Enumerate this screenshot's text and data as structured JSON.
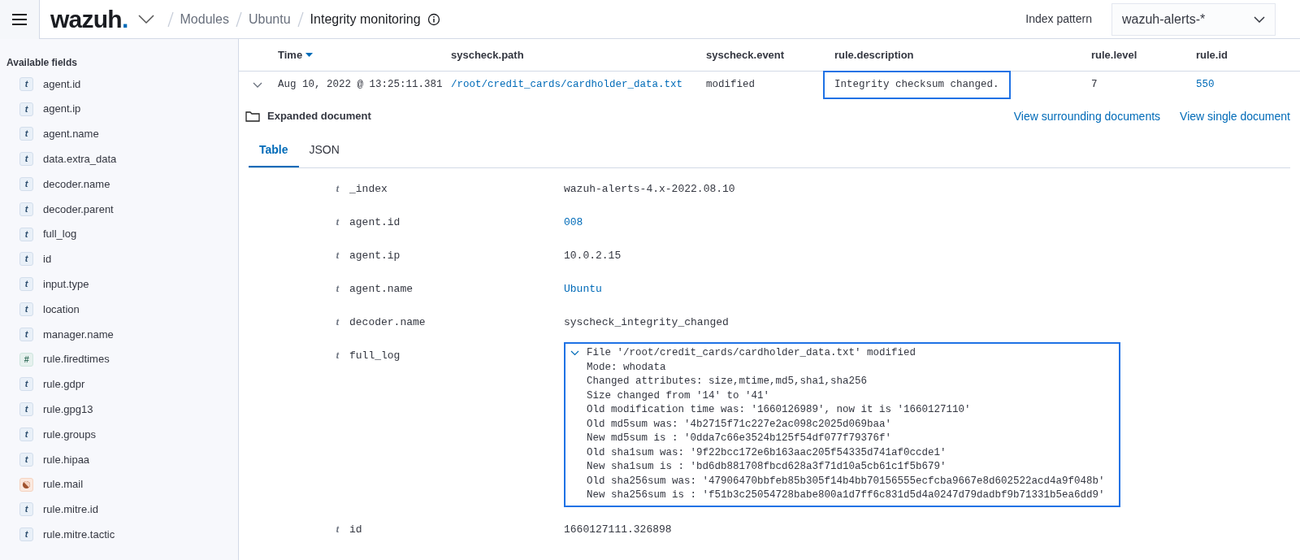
{
  "header": {
    "logo": "wazuh.",
    "breadcrumbs": [
      "Modules",
      "Ubuntu",
      "Integrity monitoring"
    ],
    "index_pattern_label": "Index pattern",
    "index_pattern_value": "wazuh-alerts-*"
  },
  "sidebar": {
    "section_title": "Available fields",
    "fields": [
      {
        "name": "agent.id",
        "kind": "string",
        "glyph": "t"
      },
      {
        "name": "agent.ip",
        "kind": "string",
        "glyph": "t"
      },
      {
        "name": "agent.name",
        "kind": "string",
        "glyph": "t"
      },
      {
        "name": "data.extra_data",
        "kind": "string",
        "glyph": "t"
      },
      {
        "name": "decoder.name",
        "kind": "string",
        "glyph": "t"
      },
      {
        "name": "decoder.parent",
        "kind": "string",
        "glyph": "t"
      },
      {
        "name": "full_log",
        "kind": "string",
        "glyph": "t"
      },
      {
        "name": "id",
        "kind": "string",
        "glyph": "t"
      },
      {
        "name": "input.type",
        "kind": "string",
        "glyph": "t"
      },
      {
        "name": "location",
        "kind": "string",
        "glyph": "t"
      },
      {
        "name": "manager.name",
        "kind": "string",
        "glyph": "t"
      },
      {
        "name": "rule.firedtimes",
        "kind": "number",
        "glyph": "#"
      },
      {
        "name": "rule.gdpr",
        "kind": "string",
        "glyph": "t"
      },
      {
        "name": "rule.gpg13",
        "kind": "string",
        "glyph": "t"
      },
      {
        "name": "rule.groups",
        "kind": "string",
        "glyph": "t"
      },
      {
        "name": "rule.hipaa",
        "kind": "string",
        "glyph": "t"
      },
      {
        "name": "rule.mail",
        "kind": "boolean"
      },
      {
        "name": "rule.mitre.id",
        "kind": "string",
        "glyph": "t"
      },
      {
        "name": "rule.mitre.tactic",
        "kind": "string",
        "glyph": "t"
      }
    ]
  },
  "table": {
    "columns": [
      {
        "label": "Time",
        "sorted": true
      },
      {
        "label": "syscheck.path",
        "sorted": false
      },
      {
        "label": "syscheck.event",
        "sorted": false
      },
      {
        "label": "rule.description",
        "sorted": false
      },
      {
        "label": "rule.level",
        "sorted": false
      },
      {
        "label": "rule.id",
        "sorted": false
      }
    ],
    "rows": [
      {
        "expanded": true,
        "cells": [
          {
            "text": "Aug 10, 2022 @ 13:25:11.381",
            "link": false,
            "highlighted": false
          },
          {
            "text": "/root/credit_cards/cardholder_data.txt",
            "link": true,
            "highlighted": false
          },
          {
            "text": "modified",
            "link": false,
            "highlighted": false
          },
          {
            "text": "Integrity checksum changed.",
            "link": false,
            "highlighted": true
          },
          {
            "text": "7",
            "link": false,
            "highlighted": false
          },
          {
            "text": "550",
            "link": true,
            "highlighted": false
          }
        ]
      }
    ]
  },
  "document": {
    "title": "Expanded document",
    "links": [
      "View surrounding documents",
      "View single document"
    ],
    "tabs": [
      {
        "label": "Table",
        "selected": true
      },
      {
        "label": "JSON",
        "selected": false
      }
    ],
    "fields": [
      {
        "glyph": "t",
        "name": "_index",
        "value": "wazuh-alerts-4.x-2022.08.10",
        "link": false,
        "highlighted": false
      },
      {
        "glyph": "t",
        "name": "agent.id",
        "value": "008",
        "link": true,
        "highlighted": false
      },
      {
        "glyph": "t",
        "name": "agent.ip",
        "value": "10.0.2.15",
        "link": false,
        "highlighted": false
      },
      {
        "glyph": "t",
        "name": "agent.name",
        "value": "Ubuntu",
        "link": true,
        "highlighted": false
      },
      {
        "glyph": "t",
        "name": "decoder.name",
        "value": "syscheck_integrity_changed",
        "link": false,
        "highlighted": false
      },
      {
        "glyph": "t",
        "name": "full_log",
        "highlighted": true,
        "expanded": true,
        "lines": [
          "File '/root/credit_cards/cardholder_data.txt' modified",
          "Mode: whodata",
          "Changed attributes: size,mtime,md5,sha1,sha256",
          "Size changed from '14' to '41'",
          "Old modification time was: '1660126989', now it is '1660127110'",
          "Old md5sum was: '4b2715f71c227e2ac098c2025d069baa'",
          "New md5sum is : '0dda7c66e3524b125f54df077f79376f'",
          "Old sha1sum was: '9f22bcc172e6b163aac205f54335d741af0ccde1'",
          "New sha1sum is : 'bd6db881708fbcd628a3f71d10a5cb61c1f5b679'",
          "Old sha256sum was: '47906470bbfeb85b305f14b4bb70156555ecfcba9667e8d602522acd4a9f048b'",
          "New sha256sum is : 'f51b3c25054728babe800a1d7ff6c831d5d4a0247d79dadbf9b71331b5ea6dd9'"
        ]
      },
      {
        "glyph": "t",
        "name": "id",
        "value": "1660127111.326898",
        "link": false,
        "highlighted": false
      }
    ]
  }
}
